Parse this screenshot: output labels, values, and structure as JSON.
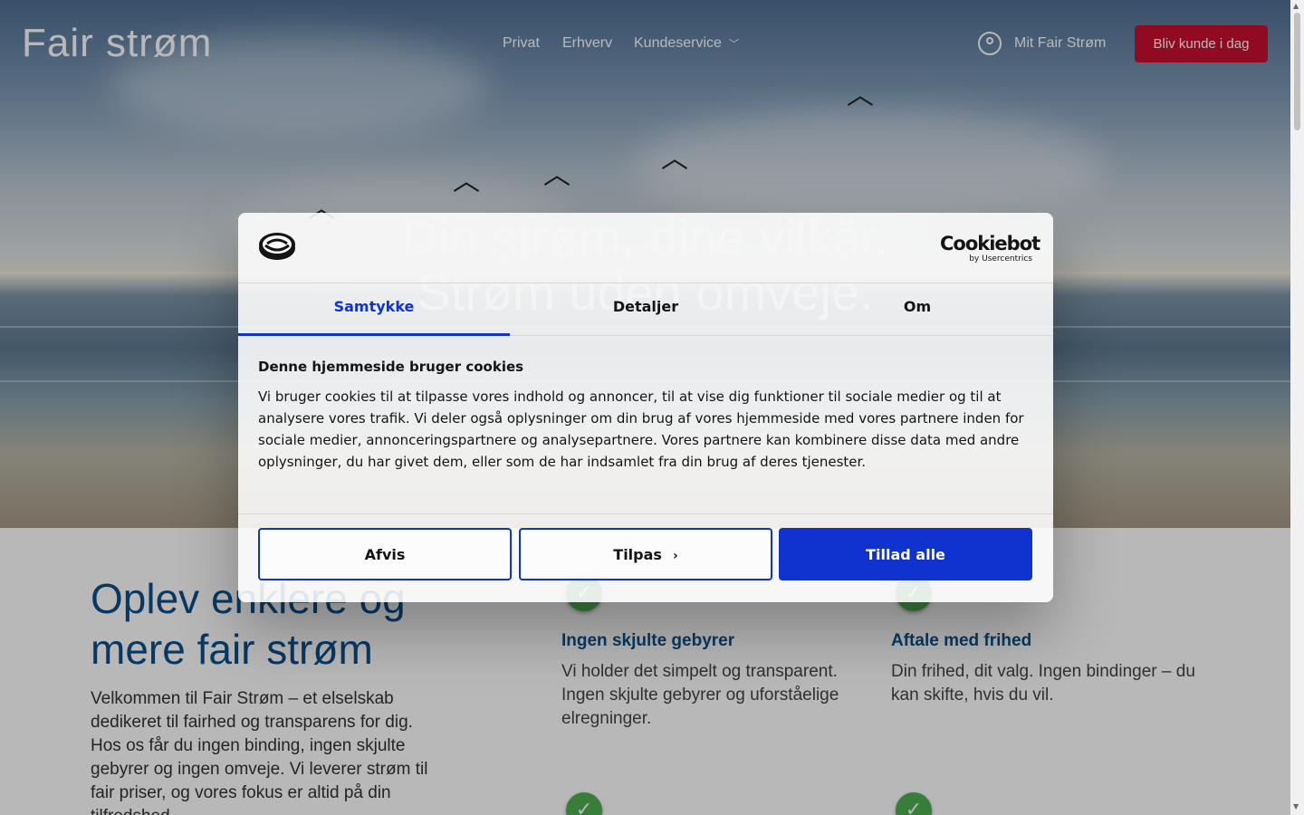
{
  "brand": {
    "logo_text": "Fair strøm"
  },
  "nav": {
    "items": [
      "Privat",
      "Erhverv",
      "Kundeservice"
    ],
    "account_label": "Mit Fair Strøm",
    "cta_label": "Bliv kunde i dag"
  },
  "hero": {
    "title_line1": "Din strøm, dine vilkår.",
    "title_line2": "Strøm uden omveje."
  },
  "content": {
    "headline": "Oplev enklere og mere fair strøm",
    "intro": "Velkommen til Fair Strøm – et elselskab dedikeret til fairhed og transparens for dig. Hos os får du ingen binding, ingen skjulte gebyrer og ingen omveje. Vi leverer strøm til fair priser, og vores fokus er altid på din tilfredshed.",
    "features": [
      {
        "title": "Ingen skjulte gebyrer",
        "text": "Vi holder det simpelt og transparent. Ingen skjulte gebyrer og uforståelige elregninger.",
        "icon": "check-icon"
      },
      {
        "title": "Aftale med frihed",
        "text": "Din frihed, dit valg. Ingen bindinger – du kan skifte, hvis du vil.",
        "icon": "check-icon"
      }
    ]
  },
  "cookie_dialog": {
    "brand_name": "Cookiebot",
    "brand_sub": "by Usercentrics",
    "tabs": [
      "Samtykke",
      "Detaljer",
      "Om"
    ],
    "active_tab": "Samtykke",
    "title": "Denne hjemmeside bruger cookies",
    "text": "Vi bruger cookies til at tilpasse vores indhold og annoncer, til at vise dig funktioner til sociale medier og til at analysere vores trafik. Vi deler også oplysninger om din brug af vores hjemmeside med vores partnere inden for sociale medier, annonceringspartnere og analysepartnere. Vores partnere kan kombinere disse data med andre oplysninger, du har givet dem, eller som de har indsamlet fra din brug af deres tjenester.",
    "buttons": {
      "reject": "Afvis",
      "customize": "Tilpas",
      "accept": "Tillad alle"
    },
    "accent_color": "#1032cf"
  },
  "colors": {
    "cta": "#c8102e",
    "heading_blue": "#0b4f8a",
    "check_green": "#4caf50"
  }
}
